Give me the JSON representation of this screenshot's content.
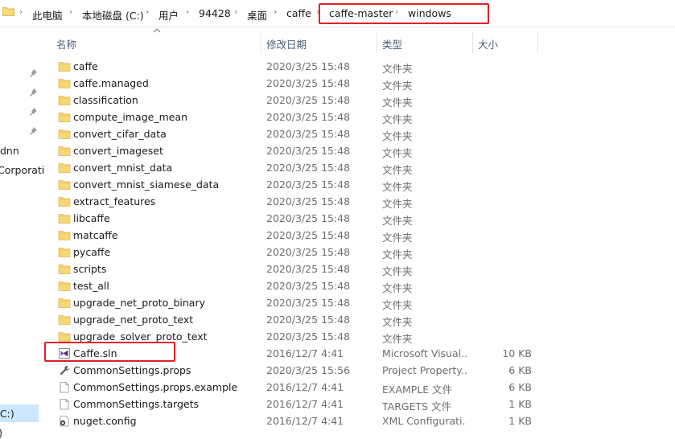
{
  "breadcrumb": {
    "items": [
      "此电脑",
      "本地磁盘 (C:)",
      "用户",
      "94428",
      "桌面",
      "caffe",
      "caffe-master",
      "windows"
    ],
    "separator": "›",
    "highlighted": [
      "caffe-master",
      "windows"
    ]
  },
  "nav": {
    "items": [
      "dnn",
      "Corporati",
      "(C:)",
      ":)"
    ],
    "selected_item": "(C:)"
  },
  "columns": {
    "name": "名称",
    "date": "修改日期",
    "type": "类型",
    "size": "大小"
  },
  "files": [
    {
      "name": "caffe",
      "date": "2020/3/25 15:48",
      "type": "文件夹",
      "size": "",
      "icon": "folder-icon"
    },
    {
      "name": "caffe.managed",
      "date": "2020/3/25 15:48",
      "type": "文件夹",
      "size": "",
      "icon": "folder-icon"
    },
    {
      "name": "classification",
      "date": "2020/3/25 15:48",
      "type": "文件夹",
      "size": "",
      "icon": "folder-icon"
    },
    {
      "name": "compute_image_mean",
      "date": "2020/3/25 15:48",
      "type": "文件夹",
      "size": "",
      "icon": "folder-icon"
    },
    {
      "name": "convert_cifar_data",
      "date": "2020/3/25 15:48",
      "type": "文件夹",
      "size": "",
      "icon": "folder-icon"
    },
    {
      "name": "convert_imageset",
      "date": "2020/3/25 15:48",
      "type": "文件夹",
      "size": "",
      "icon": "folder-icon"
    },
    {
      "name": "convert_mnist_data",
      "date": "2020/3/25 15:48",
      "type": "文件夹",
      "size": "",
      "icon": "folder-icon"
    },
    {
      "name": "convert_mnist_siamese_data",
      "date": "2020/3/25 15:48",
      "type": "文件夹",
      "size": "",
      "icon": "folder-icon"
    },
    {
      "name": "extract_features",
      "date": "2020/3/25 15:48",
      "type": "文件夹",
      "size": "",
      "icon": "folder-icon"
    },
    {
      "name": "libcaffe",
      "date": "2020/3/25 15:48",
      "type": "文件夹",
      "size": "",
      "icon": "folder-icon"
    },
    {
      "name": "matcaffe",
      "date": "2020/3/25 15:48",
      "type": "文件夹",
      "size": "",
      "icon": "folder-icon"
    },
    {
      "name": "pycaffe",
      "date": "2020/3/25 15:48",
      "type": "文件夹",
      "size": "",
      "icon": "folder-icon"
    },
    {
      "name": "scripts",
      "date": "2020/3/25 15:48",
      "type": "文件夹",
      "size": "",
      "icon": "folder-icon"
    },
    {
      "name": "test_all",
      "date": "2020/3/25 15:48",
      "type": "文件夹",
      "size": "",
      "icon": "folder-icon"
    },
    {
      "name": "upgrade_net_proto_binary",
      "date": "2020/3/25 15:48",
      "type": "文件夹",
      "size": "",
      "icon": "folder-icon"
    },
    {
      "name": "upgrade_net_proto_text",
      "date": "2020/3/25 15:48",
      "type": "文件夹",
      "size": "",
      "icon": "folder-icon"
    },
    {
      "name": "upgrade_solver_proto_text",
      "date": "2020/3/25 15:48",
      "type": "文件夹",
      "size": "",
      "icon": "folder-icon"
    },
    {
      "name": "Caffe.sln",
      "date": "2016/12/7 4:41",
      "type": "Microsoft Visual...",
      "size": "10 KB",
      "icon": "visual-studio-solution-icon",
      "highlighted": true
    },
    {
      "name": "CommonSettings.props",
      "date": "2020/3/25 15:56",
      "type": "Project Property...",
      "size": "6 KB",
      "icon": "wrench-icon"
    },
    {
      "name": "CommonSettings.props.example",
      "date": "2016/12/7 4:41",
      "type": "EXAMPLE 文件",
      "size": "6 KB",
      "icon": "file-icon"
    },
    {
      "name": "CommonSettings.targets",
      "date": "2016/12/7 4:41",
      "type": "TARGETS 文件",
      "size": "1 KB",
      "icon": "file-icon"
    },
    {
      "name": "nuget.config",
      "date": "2016/12/7 4:41",
      "type": "XML Configurati...",
      "size": "1 KB",
      "icon": "gear-file-icon"
    }
  ],
  "colors": {
    "folder": "#f8d775",
    "highlight_box": "#e0202a",
    "selection": "#cce8ff",
    "header_text": "#4c607a"
  }
}
